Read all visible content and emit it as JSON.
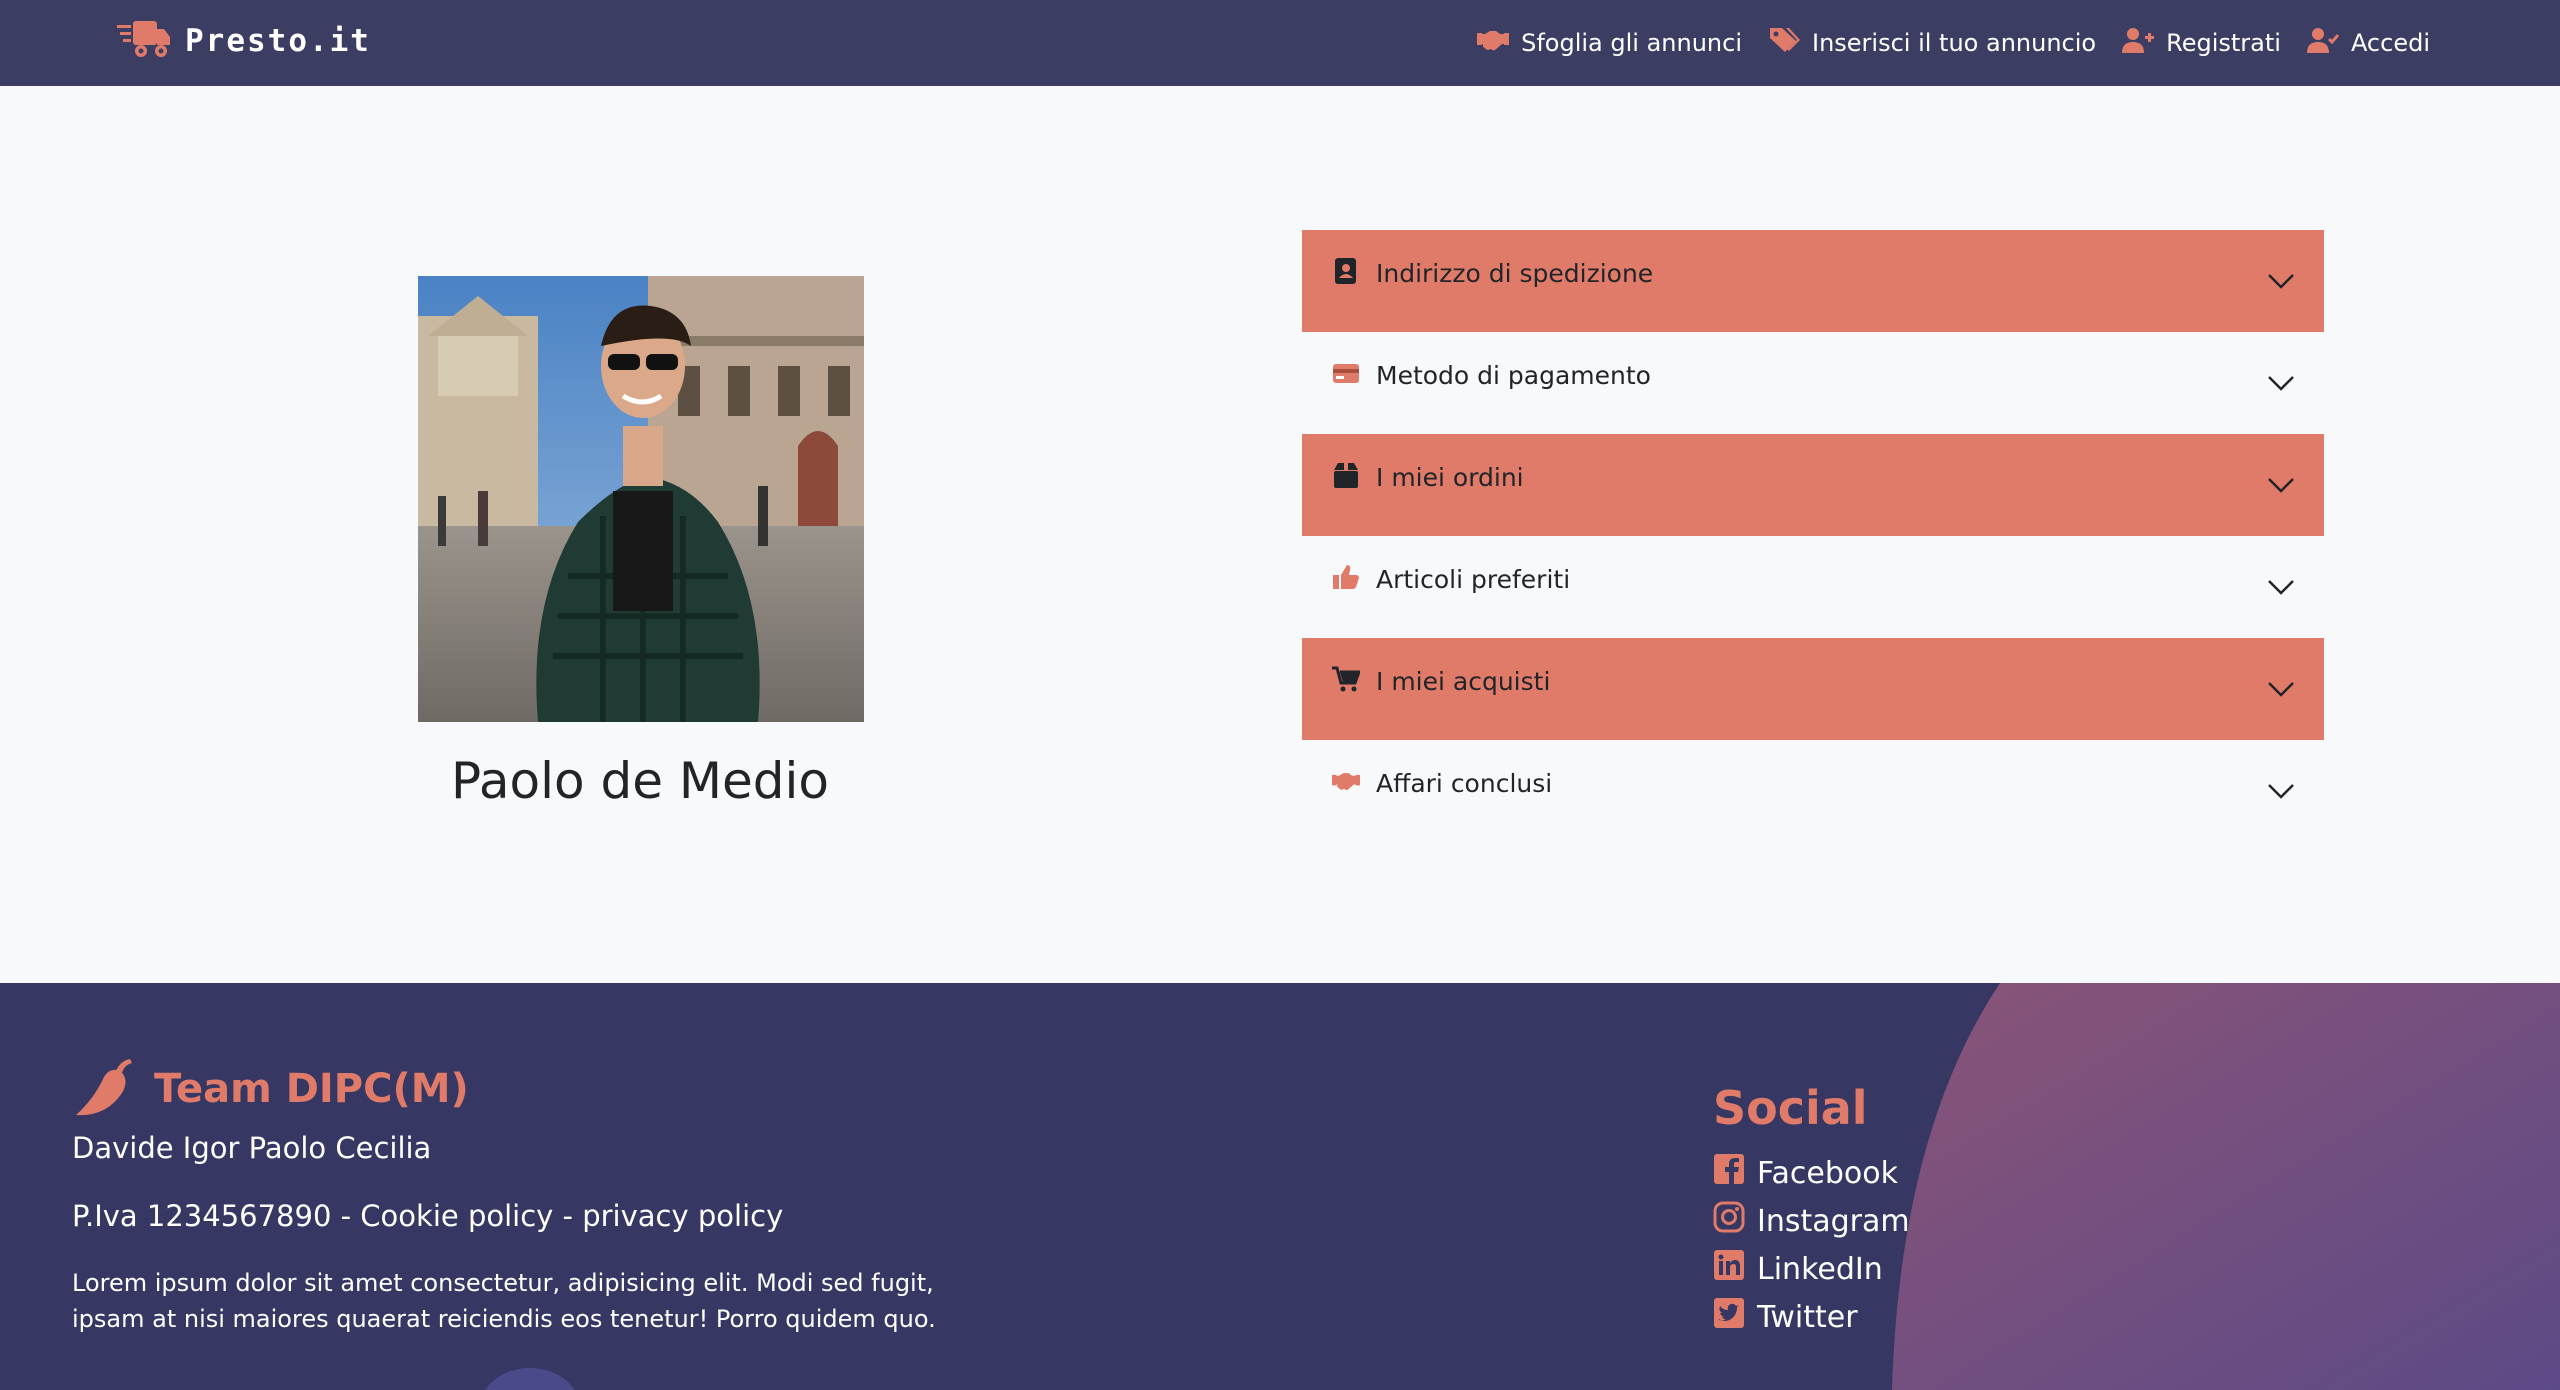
{
  "navbar": {
    "brand": "Presto.it",
    "links": [
      {
        "label": "Sfoglia gli annunci",
        "icon": "handshake-icon"
      },
      {
        "label": "Inserisci il tuo annuncio",
        "icon": "tags-icon"
      },
      {
        "label": "Registrati",
        "icon": "user-plus-icon"
      },
      {
        "label": "Accedi",
        "icon": "user-check-icon"
      }
    ]
  },
  "profile": {
    "name": "Paolo de Medio"
  },
  "accordion": [
    {
      "label": "Indirizzo di spedizione",
      "icon": "address-book-icon"
    },
    {
      "label": "Metodo di pagamento",
      "icon": "credit-card-icon"
    },
    {
      "label": "I miei ordini",
      "icon": "box-icon"
    },
    {
      "label": "Articoli preferiti",
      "icon": "thumbs-up-icon"
    },
    {
      "label": "I miei acquisti",
      "icon": "shopping-cart-icon"
    },
    {
      "label": "Affari conclusi",
      "icon": "handshake-icon"
    }
  ],
  "footer": {
    "team_title": "Team DIPC(M)",
    "members": "Davide Igor Paolo Cecilia",
    "legal": "P.Iva 1234567890 - Cookie policy - privacy policy",
    "lorem": "Lorem ipsum dolor sit amet consectetur, adipisicing elit. Modi sed fugit, ipsam at nisi maiores quaerat reiciendis eos tenetur! Porro quidem quo.",
    "social_title": "Social",
    "social": [
      {
        "label": "Facebook",
        "icon": "facebook-icon"
      },
      {
        "label": "Instagram",
        "icon": "instagram-icon"
      },
      {
        "label": "LinkedIn",
        "icon": "linkedin-icon"
      },
      {
        "label": "Twitter",
        "icon": "twitter-icon"
      }
    ]
  },
  "colors": {
    "navbar": "#3c3d62",
    "accent": "#e17b69",
    "background": "#f8f9fa",
    "footer": "#3a3c66"
  }
}
